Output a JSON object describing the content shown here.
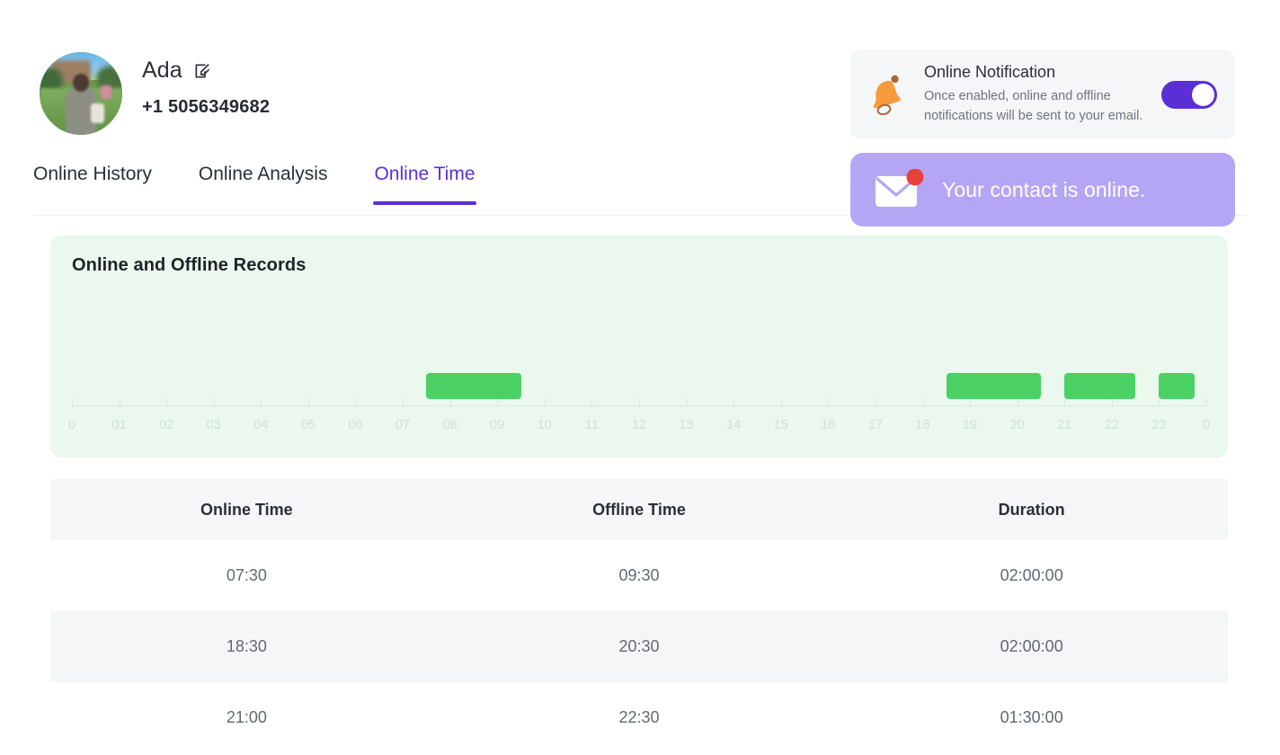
{
  "profile": {
    "name": "Ada",
    "phone": "+1 5056349682",
    "edit_icon": "edit-square-icon",
    "avatar_alt": "user-avatar"
  },
  "notification_card": {
    "icon": "bell-icon",
    "title": "Online Notification",
    "description": "Once enabled, online and offline notifications will be sent to your email.",
    "toggle_state": "on",
    "toggle_color": "#5B2FD6"
  },
  "toast": {
    "icon": "envelope-icon",
    "badge": "unread-dot",
    "message": "Your contact is online.",
    "background": "#B4A6F5",
    "badge_color": "#E8413C"
  },
  "tabs": [
    {
      "label": "Online History",
      "active": false
    },
    {
      "label": "Online Analysis",
      "active": false
    },
    {
      "label": "Online Time",
      "active": true
    }
  ],
  "chart_card": {
    "title": "Online and Offline Records",
    "background": "#EAF8EE",
    "bar_color": "#4CD264"
  },
  "chart_data": {
    "type": "bar",
    "title": "Online and Offline Records",
    "xlabel": "",
    "ylabel": "",
    "xlim": [
      0,
      24
    ],
    "grid": false,
    "legend": null,
    "tick_labels": [
      "0",
      "01",
      "02",
      "03",
      "04",
      "05",
      "06",
      "07",
      "08",
      "09",
      "10",
      "11",
      "12",
      "13",
      "14",
      "15",
      "16",
      "17",
      "18",
      "19",
      "20",
      "21",
      "22",
      "23",
      "0"
    ],
    "tick_values": [
      0,
      1,
      2,
      3,
      4,
      5,
      6,
      7,
      8,
      9,
      10,
      11,
      12,
      13,
      14,
      15,
      16,
      17,
      18,
      19,
      20,
      21,
      22,
      23,
      24
    ],
    "intervals": [
      {
        "start": "07:30",
        "end": "09:30",
        "start_hour": 7.5,
        "end_hour": 9.5,
        "duration": "02:00:00"
      },
      {
        "start": "18:30",
        "end": "20:30",
        "start_hour": 18.5,
        "end_hour": 20.5,
        "duration": "02:00:00"
      },
      {
        "start": "21:00",
        "end": "22:30",
        "start_hour": 21.0,
        "end_hour": 22.5,
        "duration": "01:30:00"
      },
      {
        "start": "23:00",
        "end": "23:45",
        "start_hour": 23.0,
        "end_hour": 23.75,
        "duration": "00:45:00"
      }
    ]
  },
  "table": {
    "columns": [
      "Online Time",
      "Offline Time",
      "Duration"
    ],
    "rows": [
      {
        "online": "07:30",
        "offline": "09:30",
        "duration": "02:00:00"
      },
      {
        "online": "18:30",
        "offline": "20:30",
        "duration": "02:00:00"
      },
      {
        "online": "21:00",
        "offline": "22:30",
        "duration": "01:30:00"
      }
    ]
  }
}
